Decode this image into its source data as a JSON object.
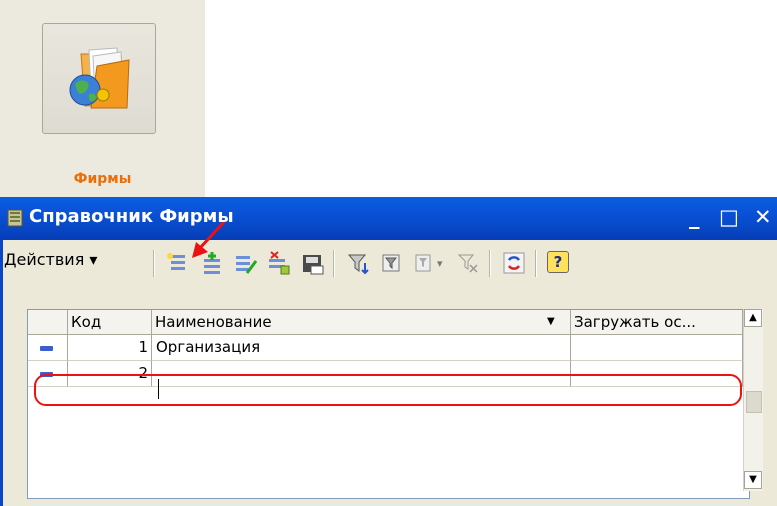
{
  "launcher": {
    "label": "Фирмы",
    "icon": "folder-globe-icon",
    "label_color": "#e8700a"
  },
  "window": {
    "title": "Справочник Фирмы",
    "minimize": "_",
    "maximize": "□",
    "close": "✕",
    "titlebar_color": "#0a52d8"
  },
  "toolbar": {
    "actions_label": "Действия",
    "actions_arrow": "▾",
    "help_label": "?"
  },
  "grid": {
    "columns": [
      "Код",
      "Наименование",
      "Загружать ос..."
    ],
    "sort_arrow": "▼",
    "rows": [
      {
        "code": "1",
        "name": "Организация",
        "load": ""
      },
      {
        "code": "2",
        "name": "",
        "load": ""
      }
    ]
  },
  "scrollbar": {
    "up": "▲",
    "down": "▼"
  },
  "annotation_color": "#ee1111"
}
